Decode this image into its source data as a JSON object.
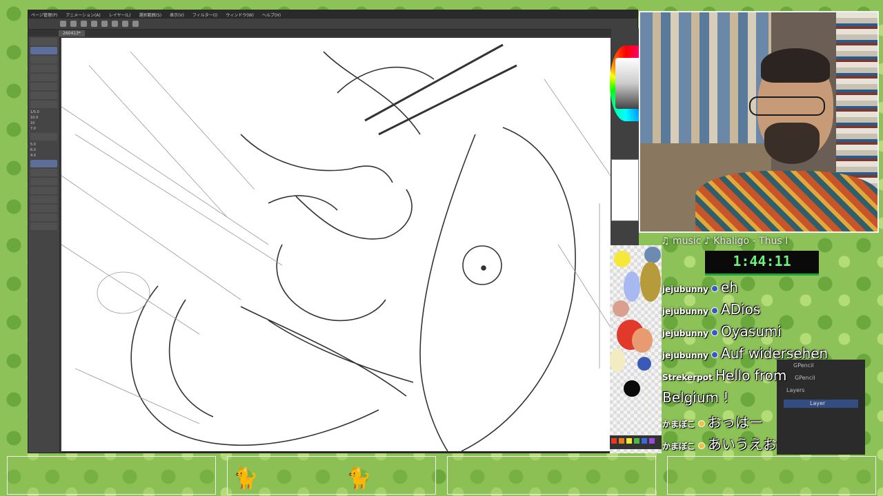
{
  "app": {
    "menu": [
      "ページ管理(P)",
      "アニメーション(A)",
      "レイヤー(L)",
      "選択範囲(S)",
      "表示(V)",
      "フィルター(I)",
      "ウィンドウ(W)",
      "ヘルプ(H)"
    ],
    "tab_label": "260413*",
    "tool_labels": [
      "1/5.0",
      "10.0",
      "10",
      "7.0",
      "5.0",
      "6.0",
      "4.0"
    ]
  },
  "music": {
    "label": "♫ music ♪ Khaligo - Thus I"
  },
  "timer": {
    "value": "1:44:11"
  },
  "chat": [
    {
      "user": "jejubunny",
      "message": "eh"
    },
    {
      "user": "jejubunny",
      "message": "ADios"
    },
    {
      "user": "jejubunny",
      "message": "Oyasumi"
    },
    {
      "user": "jejubunny",
      "message": "Auf widersehen"
    },
    {
      "user": "Strekerpot",
      "message": "Hello from"
    },
    {
      "user": "",
      "message": "Belgium !"
    },
    {
      "user": "かまぼこ",
      "message": "おっはー"
    },
    {
      "user": "かまぼこ",
      "message": "あいうえお"
    }
  ],
  "blender": {
    "breadcrumb": "GPencil",
    "object": "GPencil",
    "panel_title": "Layers",
    "layer_name": "Layer"
  },
  "colors": {
    "timer_green": "#6ef17a",
    "accent_blue": "#334d80"
  },
  "icons": [
    "undo-icon",
    "redo-icon",
    "pen-icon",
    "eraser-icon",
    "fill-icon",
    "lasso-icon"
  ]
}
